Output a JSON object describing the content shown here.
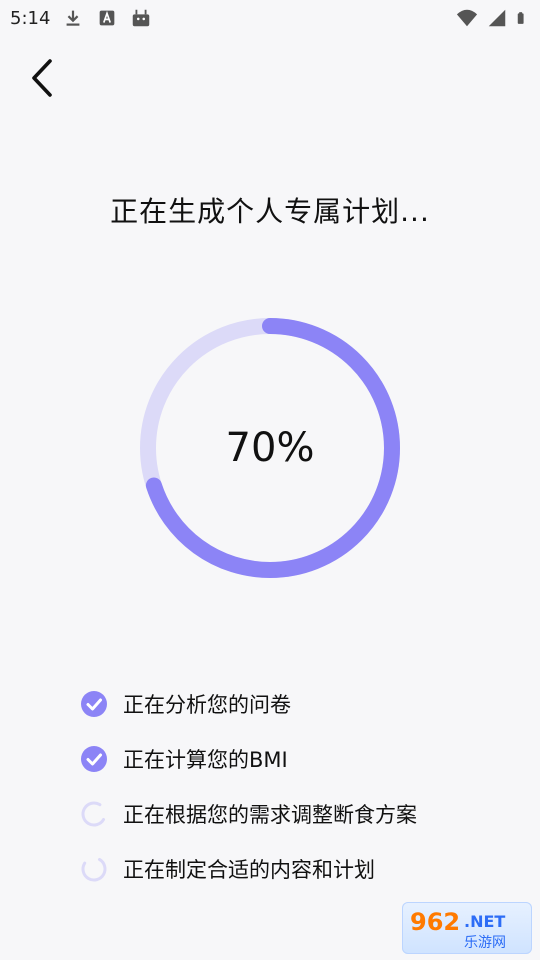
{
  "status_bar": {
    "time": "5:14",
    "left_icons": [
      "download-icon",
      "a-badge-icon",
      "android-icon"
    ],
    "right_icons": [
      "wifi-icon",
      "cell-signal-icon",
      "battery-icon"
    ]
  },
  "header": {
    "back_icon": "chevron-left-icon"
  },
  "main": {
    "title": "正在生成个人专属计划...",
    "progress": {
      "percent_text": "70%",
      "value": 0.7,
      "track_color": "#dcdaf8",
      "fill_color": "#8c84f6"
    },
    "steps": [
      {
        "label": "正在分析您的问卷",
        "status": "done"
      },
      {
        "label": "正在计算您的BMI",
        "status": "done"
      },
      {
        "label": "正在根据您的需求调整断食方案",
        "status": "loading"
      },
      {
        "label": "正在制定合适的内容和计划",
        "status": "loading"
      }
    ]
  },
  "watermark": {
    "number": "962",
    "suffix": ".NET",
    "subtitle": "乐游网"
  },
  "colors": {
    "accent": "#8c84f6",
    "accent_light": "#dcdaf8",
    "background": "#f7f7f9"
  }
}
